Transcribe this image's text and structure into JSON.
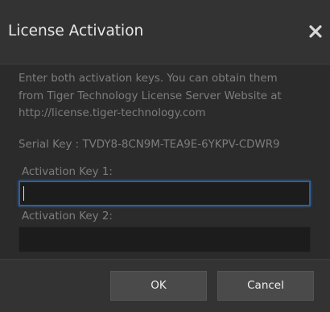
{
  "dialog": {
    "title": "License Activation",
    "close_icon": "close-icon"
  },
  "body": {
    "instructions": [
      "Enter both activation keys. You can obtain them",
      "from Tiger Technology License Server Website at",
      "http://license.tiger-technology.com"
    ],
    "serial_key": "Serial Key : TVDY8-8CN9M-TEA9E-6YKPV-CDWR9",
    "activation_key_1": {
      "label": "Activation Key 1:",
      "value": ""
    },
    "activation_key_2": {
      "label": "Activation Key 2:",
      "value": ""
    }
  },
  "footer": {
    "ok_label": "OK",
    "cancel_label": "Cancel"
  },
  "colors": {
    "background": "#2b2b2b",
    "header_footer": "#333333",
    "text_muted": "#7d7d7d",
    "focus_border": "#2f5f9a"
  }
}
